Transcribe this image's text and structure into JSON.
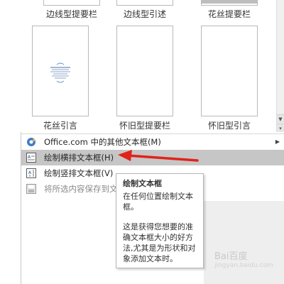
{
  "gallery": {
    "top_captions": [
      "边线型提要栏",
      "边线型引述",
      "花丝提要栏"
    ],
    "bottom_captions": [
      "花丝引言",
      "怀旧型提要栏",
      "怀旧型引言"
    ]
  },
  "menu": {
    "items": [
      {
        "label": "Office.com 中的其他文本框(M)",
        "icon": "office-icon"
      },
      {
        "label": "绘制横排文本框(H)",
        "icon": "horizontal-textbox-icon"
      },
      {
        "label": "绘制竖排文本框(V)",
        "icon": "vertical-textbox-icon"
      },
      {
        "label": "将所选内容保存到文",
        "icon": "save-selection-icon"
      }
    ]
  },
  "tooltip": {
    "title": "绘制文本框",
    "line1": "在任何位置绘制文本框。",
    "line2": "这是获得您想要的准确文本框大小的好方法,尤其是为形状和对象添加文本时。"
  },
  "watermark": {
    "text": "Bai百度",
    "sub": "jingyan.baidu.com"
  },
  "colors": {
    "highlight": "#c6c6c6",
    "annotation_arrow": "#e0231b"
  }
}
